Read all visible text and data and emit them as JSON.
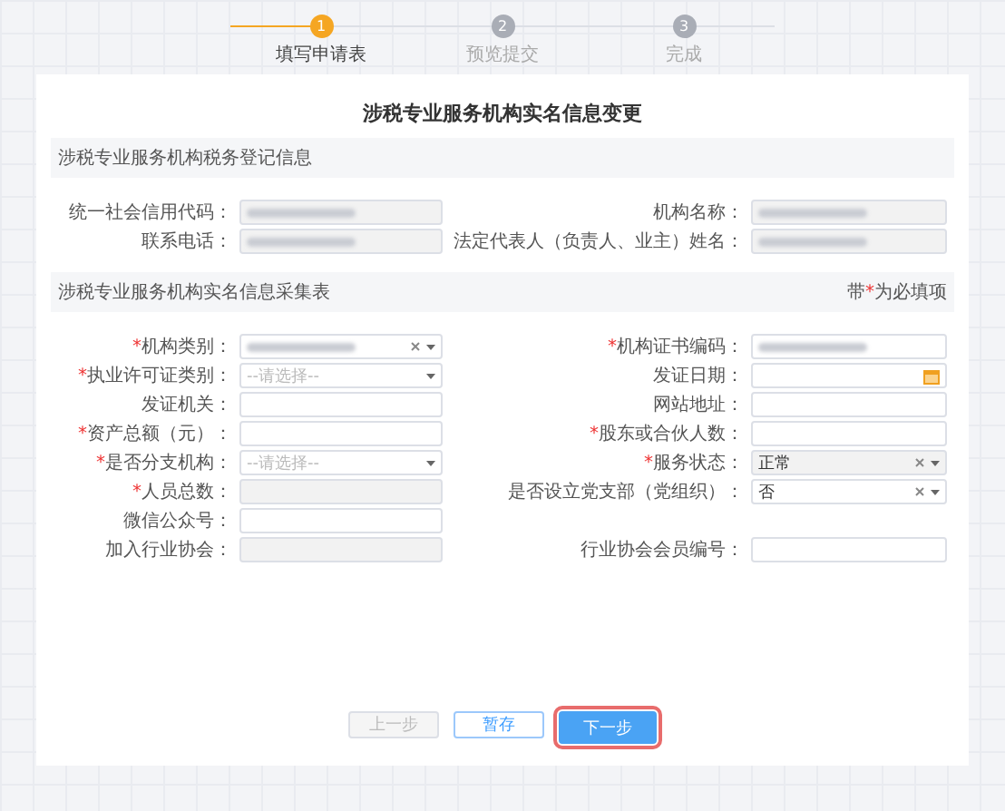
{
  "steps": [
    {
      "number": "1",
      "label": "填写申请表",
      "active": true
    },
    {
      "number": "2",
      "label": "预览提交",
      "active": false
    },
    {
      "number": "3",
      "label": "完成",
      "active": false
    }
  ],
  "title": "涉税专业服务机构实名信息变更",
  "registration": {
    "heading": "涉税专业服务机构税务登记信息",
    "rows": [
      [
        {
          "label": "统一社会信用代码：",
          "disabled": true,
          "redacted": true
        },
        {
          "label": "机构名称：",
          "disabled": true,
          "redacted": true
        }
      ],
      [
        {
          "label": "联系电话：",
          "disabled": true,
          "redacted": true
        },
        {
          "label": "法定代表人（负责人、业主）姓名：",
          "disabled": true,
          "redacted": true
        }
      ]
    ]
  },
  "collection": {
    "heading": "涉税专业服务机构实名信息采集表",
    "legend": {
      "before": "带",
      "mark": "*",
      "after": "为必填项"
    },
    "rows": [
      [
        {
          "mark": "*",
          "label": "机构类别：",
          "kind": "select",
          "disabled": false,
          "redacted": true,
          "clearable": true
        },
        {
          "mark": "*",
          "label": "机构证书编码：",
          "kind": "text",
          "disabled": false,
          "redacted": true
        }
      ],
      [
        {
          "mark": "*",
          "label": "执业许可证类别：",
          "kind": "select",
          "disabled": false,
          "placeholder": "--请选择--"
        },
        {
          "label": "发证日期：",
          "kind": "date",
          "disabled": false
        }
      ],
      [
        {
          "label": "发证机关：",
          "kind": "text",
          "disabled": false
        },
        {
          "label": "网站地址：",
          "kind": "text",
          "disabled": false
        }
      ],
      [
        {
          "mark": "*",
          "label": "资产总额（元）：",
          "kind": "text",
          "disabled": false
        },
        {
          "mark": "*",
          "label": "股东或合伙人数：",
          "kind": "text",
          "disabled": false
        }
      ],
      [
        {
          "mark": "*",
          "label": "是否分支机构：",
          "kind": "select",
          "disabled": false,
          "placeholder": "--请选择--"
        },
        {
          "mark": "*",
          "label": "服务状态：",
          "kind": "select",
          "disabled": true,
          "value": "正常",
          "clearable": true
        }
      ],
      [
        {
          "mark": "*",
          "label": "人员总数：",
          "kind": "text",
          "disabled": true
        },
        {
          "label": "是否设立党支部（党组织）：",
          "kind": "select",
          "disabled": false,
          "value": "否",
          "clearable": true
        }
      ],
      [
        {
          "label": "微信公众号：",
          "kind": "text",
          "disabled": false
        },
        null
      ],
      [
        {
          "label": "加入行业协会：",
          "kind": "text",
          "disabled": true
        },
        {
          "label": "行业协会会员编号：",
          "kind": "text",
          "disabled": false
        }
      ]
    ]
  },
  "buttons": [
    {
      "label": "上一步",
      "kind": "default",
      "highlighted": false
    },
    {
      "label": "暂存",
      "kind": "outline",
      "highlighted": false
    },
    {
      "label": "下一步",
      "kind": "primary",
      "highlighted": true
    }
  ]
}
